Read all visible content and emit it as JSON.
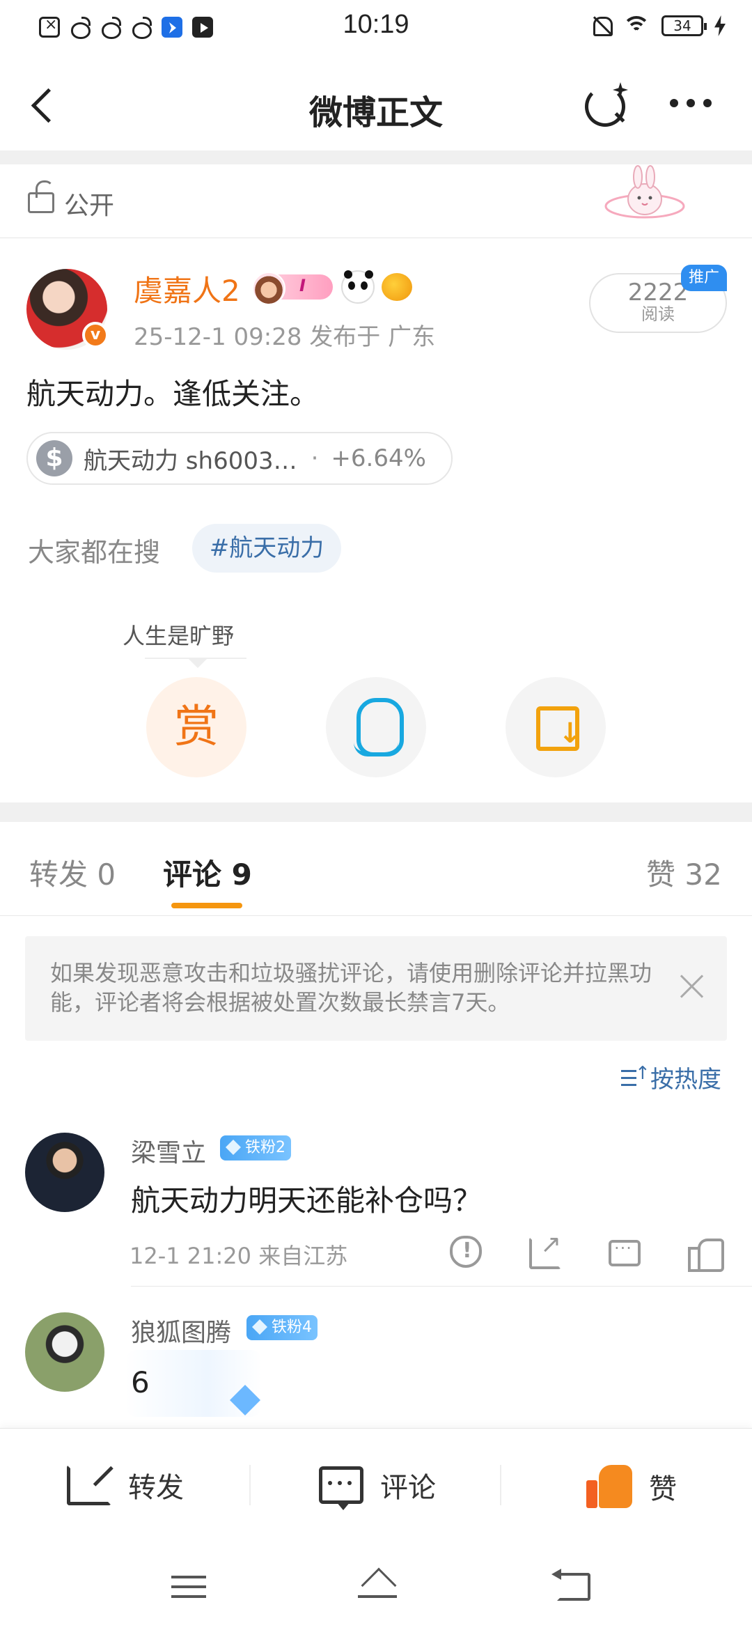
{
  "status_bar": {
    "time": "10:19",
    "battery": "34",
    "icons": [
      "notification-icon",
      "weibo-icon",
      "weibo-icon",
      "weibo-icon",
      "app-icon",
      "play-icon",
      "mute-icon",
      "wifi-icon",
      "battery-icon",
      "charging-icon"
    ]
  },
  "nav": {
    "title": "微博正文",
    "icons": [
      "back-icon",
      "ai-search-icon",
      "more-icon"
    ]
  },
  "visibility": {
    "label": "公开"
  },
  "post": {
    "author": "虞嘉人2",
    "meta": "25-12-1 09:28  发布于 广东",
    "read_count": "2222",
    "read_label": "阅读",
    "promo_tag": "推广",
    "text": "航天动力。逢低关注。",
    "stock": {
      "icon": "$",
      "name": "航天动力 sh6003…",
      "separator": "·",
      "change": "+6.64%"
    },
    "search_label": "大家都在搜",
    "topic": "#航天动力",
    "tip_label": "人生是旷野",
    "reward_label": "赏"
  },
  "tabs": {
    "repost": "转发 0",
    "comment": "评论 9",
    "like": "赞 32"
  },
  "notice": {
    "text": "如果发现恶意攻击和垃圾骚扰评论，请使用删除评论并拉黑功能，评论者将会根据被处置次数最长禁言7天。"
  },
  "sort": {
    "label": "按热度"
  },
  "comments": [
    {
      "name": "梁雪立",
      "badge": "铁粉2",
      "text": "航天动力明天还能补仓吗？",
      "meta": "12-1 21:20  来自江苏"
    },
    {
      "name": "狼狐图腾",
      "badge": "铁粉4",
      "text": "6"
    }
  ],
  "bottom_bar": {
    "repost": "转发",
    "comment": "评论",
    "like": "赞"
  },
  "colors": {
    "accent_orange": "#f07416",
    "link_blue": "#3a6ea8",
    "tab_underline": "#f5960f",
    "like_orange": "#f58a1f"
  }
}
